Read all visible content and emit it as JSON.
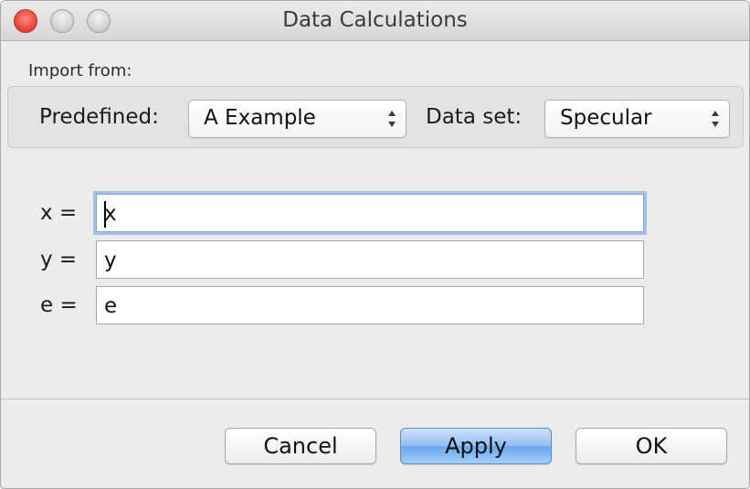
{
  "window": {
    "title": "Data Calculations"
  },
  "import": {
    "label": "Import from:",
    "predefined_label": "Predefined:",
    "predefined_value": "A Example",
    "dataset_label": "Data set:",
    "dataset_value": "Specular"
  },
  "fields": [
    {
      "label": "x =",
      "value": "x"
    },
    {
      "label": "y =",
      "value": "y"
    },
    {
      "label": "e =",
      "value": "e"
    }
  ],
  "buttons": {
    "cancel": "Cancel",
    "apply": "Apply",
    "ok": "OK"
  }
}
